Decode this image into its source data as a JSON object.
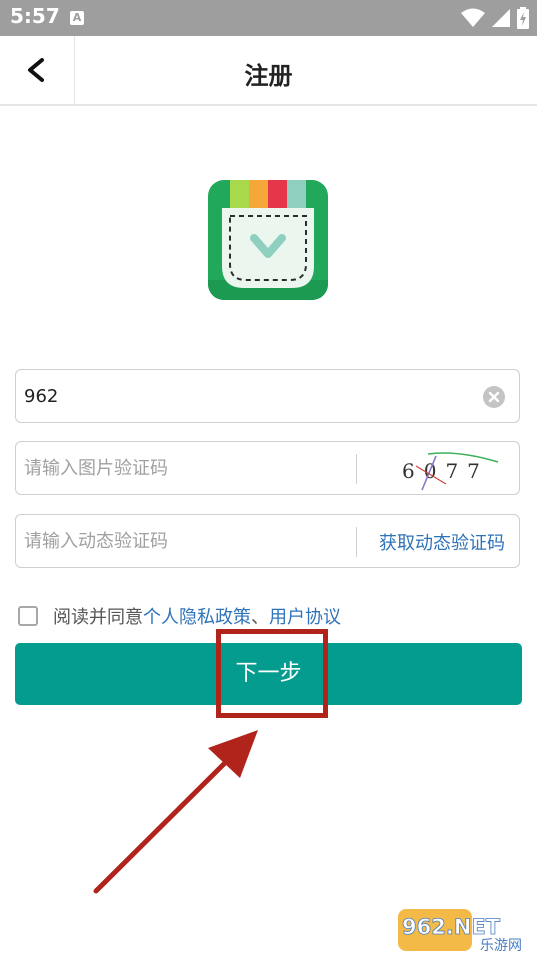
{
  "status_bar": {
    "time": "5:57",
    "notification_icon": "A"
  },
  "nav": {
    "title": "注册"
  },
  "form": {
    "phone": {
      "value": "962",
      "placeholder": ""
    },
    "image_code": {
      "placeholder": "请输入图片验证码",
      "captcha_text": "6077"
    },
    "sms_code": {
      "placeholder": "请输入动态验证码",
      "get_code_label": "获取动态验证码"
    }
  },
  "agreement": {
    "checked": false,
    "prefix": "阅读并同意",
    "privacy_link": "个人隐私政策",
    "separator": "、",
    "terms_link": "用户协议"
  },
  "next_button": {
    "label": "下一步"
  },
  "colors": {
    "accent": "#049c8e",
    "link": "#2f73b8",
    "annotation": "#b0241c",
    "status_bar": "#9e9e9e"
  },
  "watermark": {
    "brand": "962.NET",
    "subtitle": "乐游网"
  }
}
